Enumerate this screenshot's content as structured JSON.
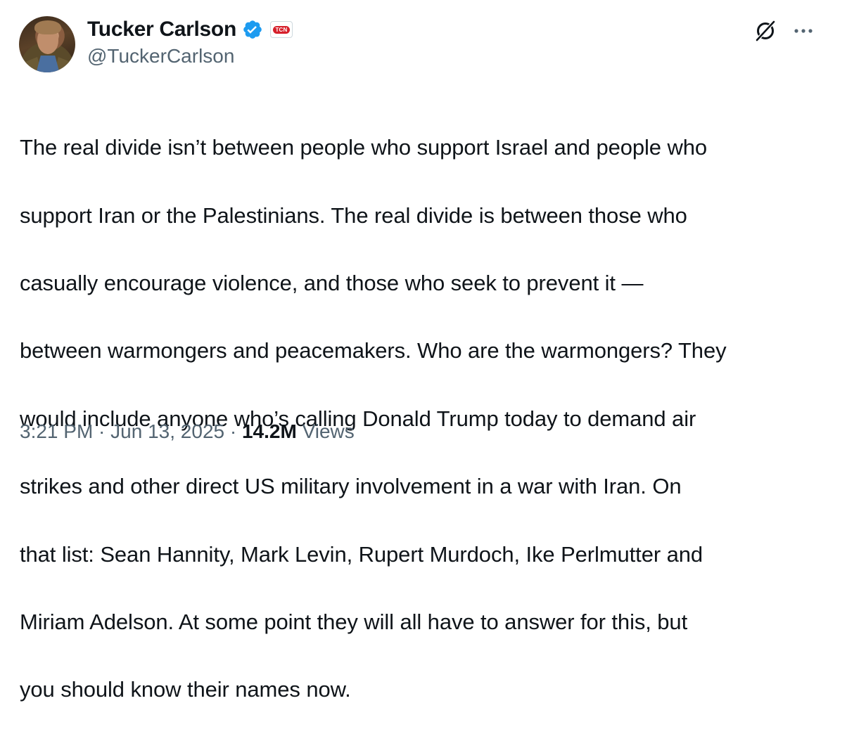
{
  "author": {
    "display_name": "Tucker Carlson",
    "handle": "@TuckerCarlson",
    "verified": true,
    "affiliate_badge": "TCN",
    "verified_color": "#1d9bf0"
  },
  "icons": {
    "verified": "verified-check-icon",
    "affiliate": "tcn-affiliate-badge-icon",
    "grok": "grok-icon",
    "more": "more-options-icon"
  },
  "tweet": {
    "text_lines": [
      "The real divide isn’t between people who support Israel and people who",
      "support Iran or the Palestinians. The real divide is between those who",
      "casually encourage violence, and those who seek to prevent it —",
      "between warmongers and peacemakers. Who are the warmongers? They",
      "would include anyone who’s calling Donald Trump today to demand air",
      "strikes and other direct US military involvement in a war with Iran. On",
      "that list: Sean Hannity, Mark Levin, Rupert Murdoch, Ike Perlmutter and",
      "Miriam Adelson. At some point they will all have to answer for this, but",
      "you should know their names now."
    ],
    "time": "3:21 PM",
    "separator": " · ",
    "date": "Jun 13, 2025",
    "views_count": "14.2M",
    "views_label": " Views"
  },
  "colors": {
    "text": "#0f1419",
    "secondary": "#536471",
    "verified": "#1d9bf0"
  }
}
